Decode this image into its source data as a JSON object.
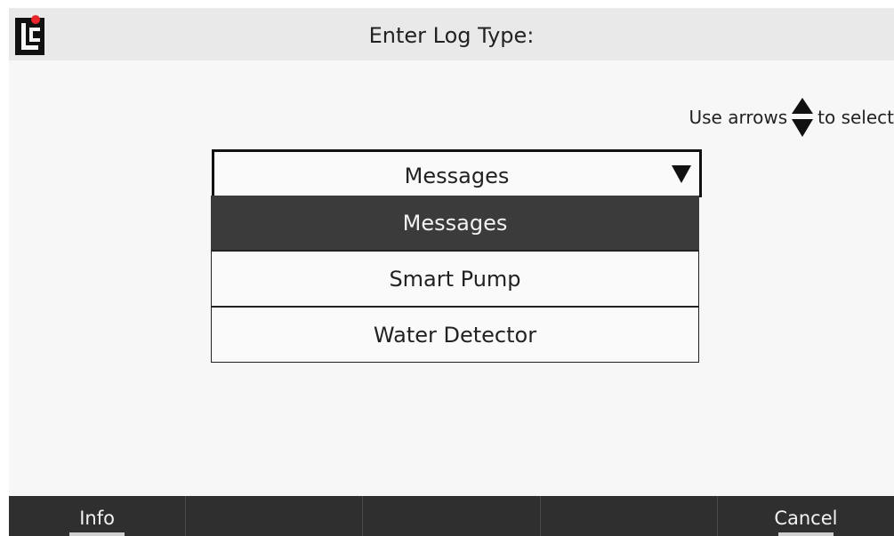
{
  "header": {
    "title": "Enter Log Type:",
    "logo_text": "LC",
    "logo_dot_color": "#e8262b"
  },
  "hint": {
    "before": "Use arrows",
    "icon": "up-down-arrows-icon",
    "after": "to select"
  },
  "dropdown": {
    "selected_value": "Messages",
    "caret_icon": "triangle-down-icon",
    "options": [
      {
        "label": "Messages",
        "selected": true
      },
      {
        "label": "Smart Pump",
        "selected": false
      },
      {
        "label": "Water Detector",
        "selected": false
      }
    ]
  },
  "softkeys": [
    {
      "label": "Info",
      "active": true
    },
    {
      "label": "",
      "active": false
    },
    {
      "label": "",
      "active": false
    },
    {
      "label": "",
      "active": false
    },
    {
      "label": "Cancel",
      "active": true
    }
  ],
  "colors": {
    "header_bg": "#e9e9e9",
    "screen_bg": "#f7f7f7",
    "selected_bg": "#3b3b3b",
    "softkey_bg": "#2f2f2f"
  }
}
